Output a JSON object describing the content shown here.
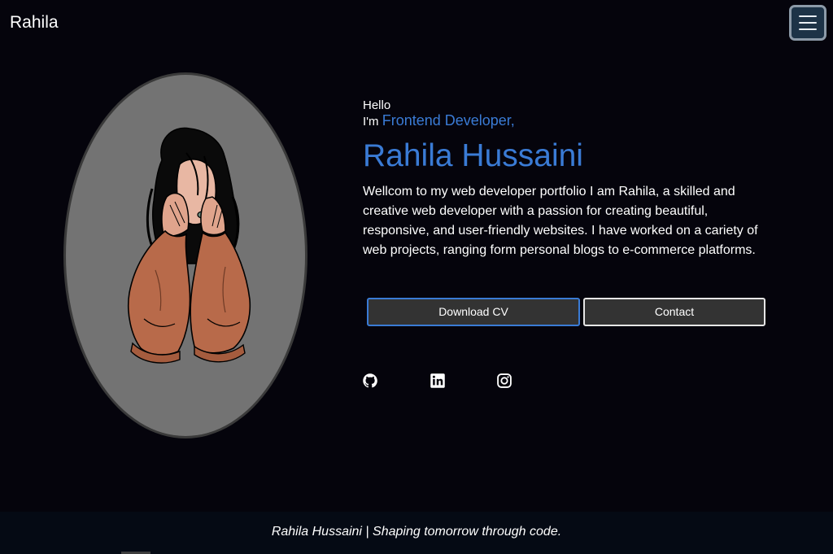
{
  "header": {
    "brand": "Rahila",
    "menu_icon": "hamburger-menu-icon"
  },
  "hero": {
    "greeting": "Hello",
    "role_prefix": "I'm",
    "role": "Frontend Developer,",
    "name": "Rahila Hussaini",
    "bio": "Wellcom to my web developer portfolio I am Rahila, a skilled and creative web developer with a passion for creating beautiful, responsive, and user-friendly websites. I have worked on a cariety of web projects, ranging form personal blogs to e-commerce platforms.",
    "portrait_icon": "portrait-illustration"
  },
  "actions": {
    "download_cv": "Download CV",
    "contact": "Contact"
  },
  "social": [
    {
      "icon": "github-icon"
    },
    {
      "icon": "linkedin-icon"
    },
    {
      "icon": "instagram-icon"
    }
  ],
  "footer": {
    "text": "Rahila Hussaini | Shaping tomorrow through code."
  },
  "colors": {
    "background": "#05040c",
    "accent": "#3a7bd5",
    "footer_background": "#050a14",
    "button_background": "#333333"
  }
}
